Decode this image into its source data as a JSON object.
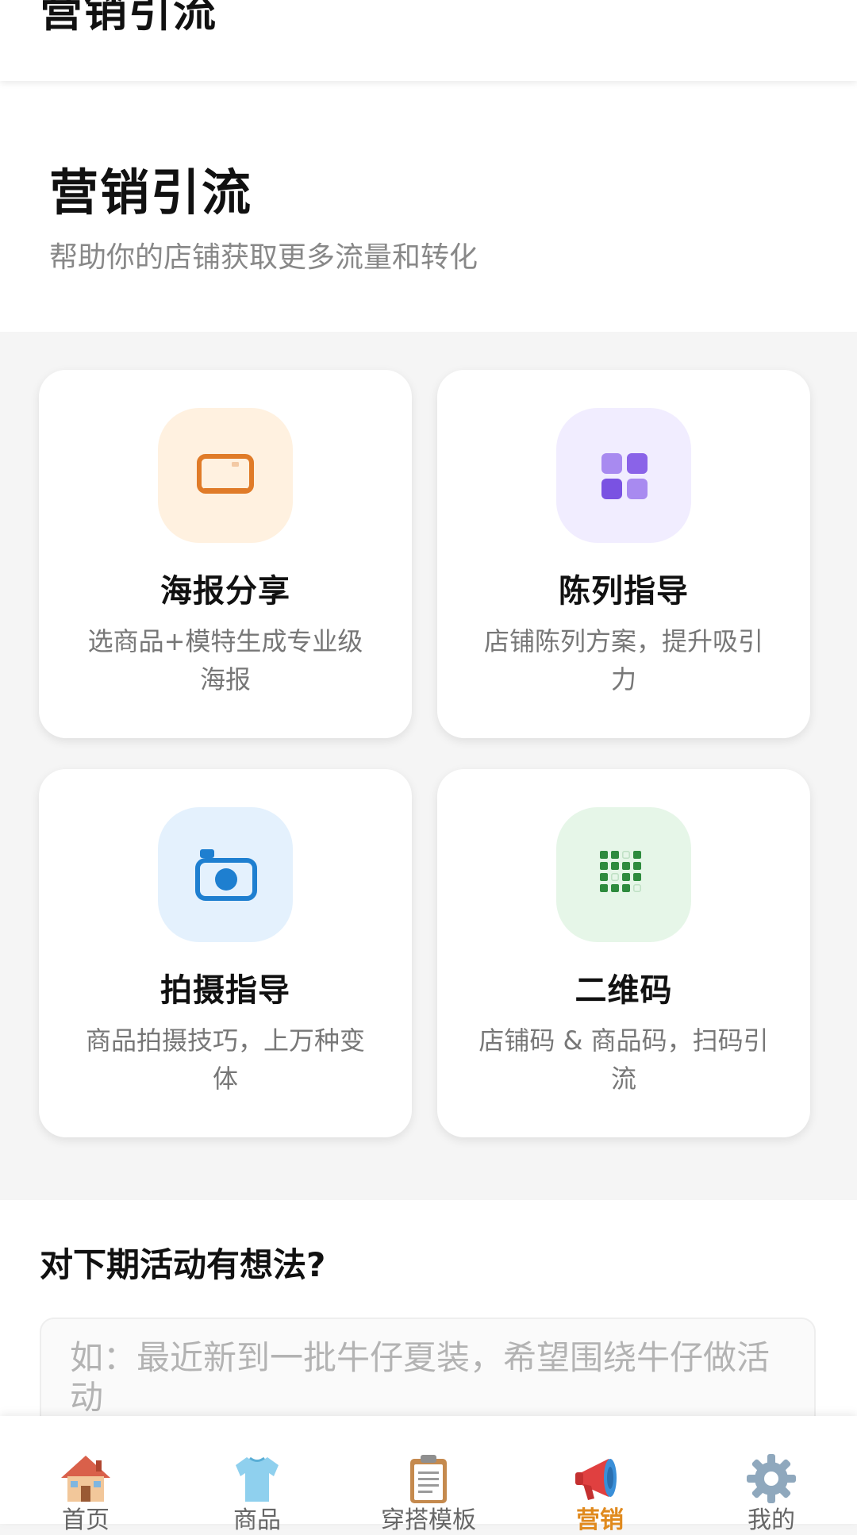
{
  "header": {
    "title": "营销引流"
  },
  "hero": {
    "title": "营销引流",
    "subtitle": "帮助你的店铺获取更多流量和转化"
  },
  "cards": [
    {
      "title": "海报分享",
      "desc": "选商品+模特生成专业级海报",
      "icon": "poster-icon",
      "tile_color": "#fff1e0",
      "icon_color": "#e07b28"
    },
    {
      "title": "陈列指导",
      "desc": "店铺陈列方案，提升吸引力",
      "icon": "grid-icon",
      "tile_color": "#f1edff",
      "icon_color": "#8a63e8"
    },
    {
      "title": "拍摄指导",
      "desc": "商品拍摄技巧，上万种变体",
      "icon": "camera-icon",
      "tile_color": "#e4f1fd",
      "icon_color": "#1e7fd0"
    },
    {
      "title": "二维码",
      "desc": "店铺码 & 商品码，扫码引流",
      "icon": "qr-code-icon",
      "tile_color": "#e6f6e8",
      "icon_color": "#2e8b3e"
    }
  ],
  "feedback": {
    "title": "对下期活动有想法?",
    "placeholder": "如：最近新到一批牛仔夏装，希望围绕牛仔做活动"
  },
  "tabs": [
    {
      "label": "首页",
      "icon": "home-icon",
      "active": false
    },
    {
      "label": "商品",
      "icon": "tshirt-icon",
      "active": false
    },
    {
      "label": "穿搭模板",
      "icon": "clipboard-icon",
      "active": false
    },
    {
      "label": "营销",
      "icon": "megaphone-icon",
      "active": true
    },
    {
      "label": "我的",
      "icon": "gear-icon",
      "active": false
    }
  ],
  "colors": {
    "accent": "#e08a1e",
    "page_background": "#f5f5f5"
  }
}
